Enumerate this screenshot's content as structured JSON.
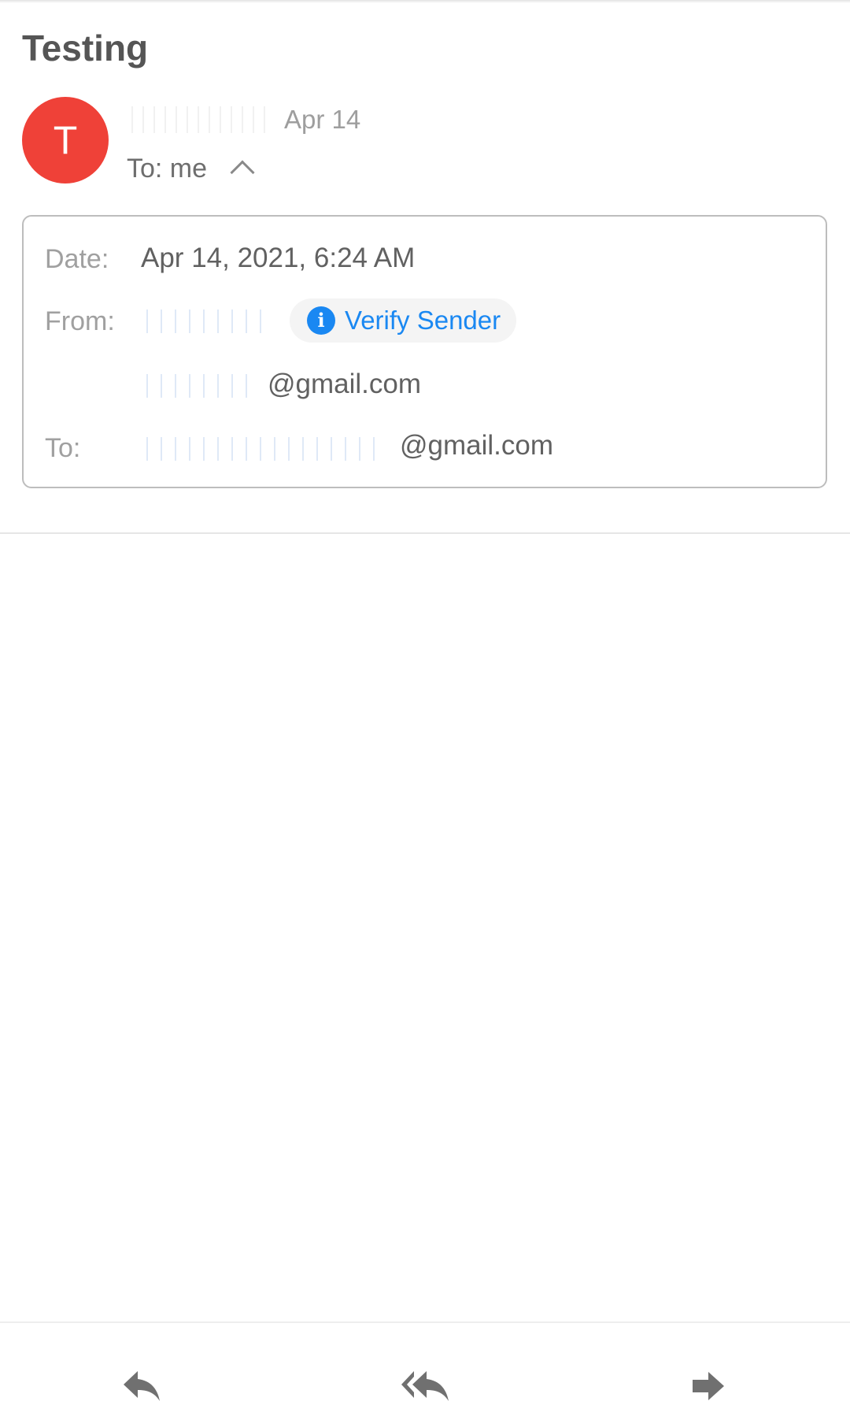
{
  "email": {
    "subject": "Testing",
    "avatar_letter": "T",
    "sender_date": "Apr 14",
    "to_summary": "To: me"
  },
  "details": {
    "date_label": "Date:",
    "date_value": "Apr 14, 2021, 6:24 AM",
    "from_label": "From:",
    "verify_sender": "Verify Sender",
    "from_email_domain": "@gmail.com",
    "to_label": "To:",
    "to_email_domain": "@gmail.com"
  },
  "icons": {
    "expand": "chevron-up-icon",
    "verify": "info-icon",
    "reply": "reply-icon",
    "reply_all": "reply-all-icon",
    "forward": "forward-icon"
  },
  "colors": {
    "avatar": "#ef4138",
    "accent": "#1a88f2",
    "icon_gray": "#707070"
  }
}
